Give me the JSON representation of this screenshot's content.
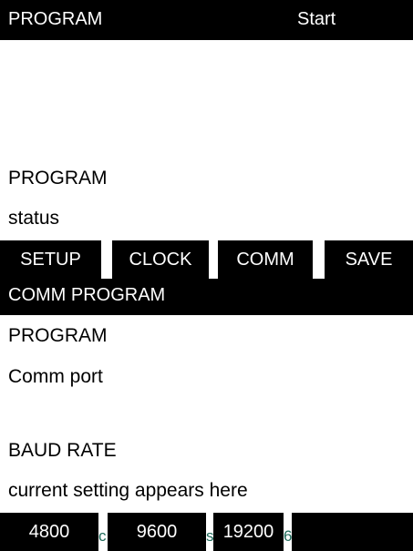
{
  "header": {
    "left": "PROGRAM",
    "right": "Start"
  },
  "prompt": {
    "line1": "PROGRAM",
    "line2": "status"
  },
  "menu": [
    {
      "label": "SETUP"
    },
    {
      "label": "CLOCK"
    },
    {
      "label": "COMM"
    },
    {
      "label": "SAVE"
    }
  ],
  "section": {
    "title": "COMM PROGRAM"
  },
  "comm": {
    "line1": "PROGRAM",
    "line2": "Comm port"
  },
  "baud": {
    "label": "BAUD RATE",
    "hint": "current setting appears here"
  },
  "baud_options": [
    {
      "label": "4800"
    },
    {
      "label": "9600"
    },
    {
      "label": "19200"
    }
  ],
  "stray_glyphs": [
    "c",
    "s",
    "6"
  ]
}
